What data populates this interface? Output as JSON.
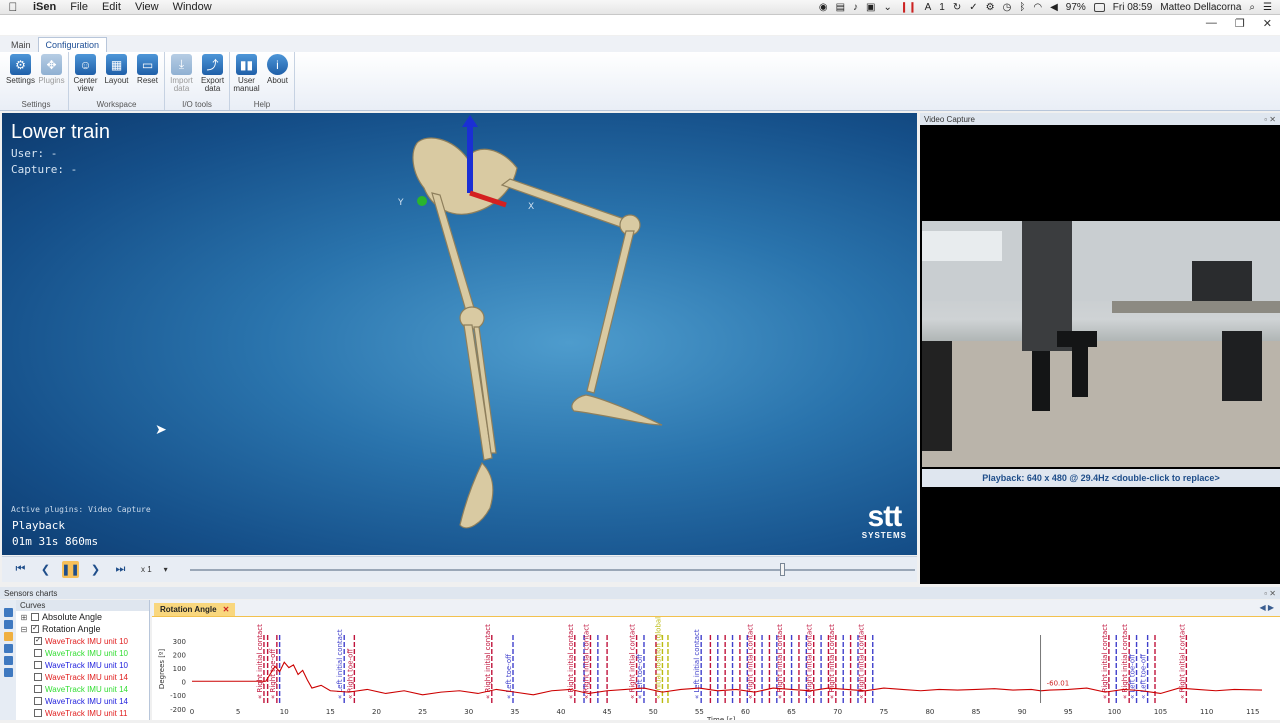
{
  "menubar": {
    "app_name": "iSen",
    "items": [
      "File",
      "Edit",
      "View",
      "Window"
    ],
    "battery": "97%",
    "clock": "Fri 08:59",
    "user": "Matteo Dellacorna",
    "notif_count": "1"
  },
  "window": {
    "minimize": "—",
    "restore": "❐",
    "close": "✕"
  },
  "tabs": [
    "Main",
    "Configuration"
  ],
  "ribbon": {
    "groups": [
      {
        "label": "Settings",
        "buttons": [
          {
            "label": "Settings",
            "icon": "gears-icon"
          },
          {
            "label": "Plugins",
            "icon": "puzzle-icon"
          }
        ]
      },
      {
        "label": "Workspace",
        "buttons": [
          {
            "label": "Center view",
            "icon": "person-center-icon"
          },
          {
            "label": "Layout",
            "icon": "layout-icon"
          },
          {
            "label": "Reset",
            "icon": "reset-icon"
          }
        ]
      },
      {
        "label": "I/O tools",
        "buttons": [
          {
            "label": "Import data",
            "icon": "import-icon"
          },
          {
            "label": "Export data",
            "icon": "export-icon"
          }
        ]
      },
      {
        "label": "Help",
        "buttons": [
          {
            "label": "User manual",
            "icon": "book-icon"
          },
          {
            "label": "About",
            "icon": "info-icon"
          }
        ]
      }
    ]
  },
  "viewport": {
    "title": "Lower train",
    "user_label": "User: -",
    "capture_label": "Capture: -",
    "plugins": "Active plugins: Video Capture",
    "mode": "Playback",
    "time": "01m 31s 860ms",
    "axis_x": "X",
    "axis_y": "Y",
    "logo_main": "stt",
    "logo_sub": "SYSTEMS"
  },
  "playback": {
    "speed": "x 1",
    "progress": 0.82
  },
  "video": {
    "title": "Video Capture",
    "caption": "Playback: 640 x 480 @ 29.4Hz <double-click to replace>"
  },
  "sensors": {
    "title": "Sensors charts",
    "curves_header": "Curves",
    "tree": [
      {
        "label": "Absolute Angle",
        "level": 0,
        "checked": false,
        "color": "#222222"
      },
      {
        "label": "Rotation Angle",
        "level": 0,
        "checked": true,
        "color": "#222222"
      },
      {
        "label": "WaveTrack IMU unit 10",
        "level": 1,
        "checked": true,
        "color": "#e02020"
      },
      {
        "label": "WaveTrack IMU unit 10",
        "level": 1,
        "checked": false,
        "color": "#33dd33"
      },
      {
        "label": "WaveTrack IMU unit 10",
        "level": 1,
        "checked": false,
        "color": "#2222dd"
      },
      {
        "label": "WaveTrack IMU unit 14",
        "level": 1,
        "checked": false,
        "color": "#e02020"
      },
      {
        "label": "WaveTrack IMU unit 14",
        "level": 1,
        "checked": false,
        "color": "#33dd33"
      },
      {
        "label": "WaveTrack IMU unit 14",
        "level": 1,
        "checked": false,
        "color": "#2222dd"
      },
      {
        "label": "WaveTrack IMU unit 11",
        "level": 1,
        "checked": false,
        "color": "#e02020"
      }
    ],
    "chart_tab": "Rotation Angle"
  },
  "chart_data": {
    "type": "line",
    "ylabel": "Degrees [º]",
    "xlabel": "Time [s]",
    "xlim": [
      0,
      116
    ],
    "ylim": [
      -150,
      350
    ],
    "yticks": [
      300,
      200,
      100,
      0,
      -100,
      -200
    ],
    "xticks": [
      0,
      5,
      10,
      15,
      20,
      25,
      30,
      35,
      40,
      45,
      50,
      55,
      60,
      65,
      70,
      75,
      80,
      85,
      90,
      95,
      100,
      105,
      110,
      115
    ],
    "cursor": {
      "x": 92,
      "label": "-60.01"
    },
    "series": [
      {
        "color": "#cc0000",
        "x": [
          0,
          8,
          9,
          9.5,
          10,
          10.5,
          11,
          11.5,
          12,
          12.5,
          13,
          14,
          15,
          17,
          19,
          21,
          23,
          25,
          27,
          29,
          31,
          33,
          35,
          37,
          39,
          41,
          43,
          45,
          47,
          49,
          51,
          53,
          55,
          57,
          59,
          61,
          63,
          65,
          67,
          69,
          71,
          73,
          75,
          77,
          79,
          81,
          83,
          85,
          87,
          89,
          91,
          92,
          93,
          95,
          97,
          99,
          101,
          103,
          105,
          107,
          109,
          111,
          113,
          116
        ],
        "y": [
          10,
          10,
          120,
          80,
          150,
          110,
          130,
          60,
          90,
          20,
          -40,
          -20,
          -60,
          -70,
          -50,
          -80,
          -60,
          -90,
          -70,
          -60,
          -80,
          -50,
          -70,
          -90,
          -60,
          -50,
          -80,
          -60,
          -50,
          -40,
          -70,
          -50,
          -40,
          -60,
          -50,
          -70,
          -40,
          -50,
          -60,
          -40,
          -50,
          -60,
          -40,
          -50,
          -60,
          -50,
          -55,
          -50,
          -45,
          -55,
          -50,
          -60,
          -55,
          -50,
          -40,
          -70,
          -50,
          -60,
          -80,
          -40,
          -50,
          -60,
          -50,
          -55
        ]
      }
    ],
    "events": [
      {
        "x": 7.8,
        "label": "Right initial contact",
        "color": "#c0143c"
      },
      {
        "x": 8.2,
        "label": "",
        "color": "#c0143c"
      },
      {
        "x": 9.2,
        "label": "Right toe-off",
        "color": "#c0143c"
      },
      {
        "x": 9.5,
        "label": "",
        "color": "#4040cc"
      },
      {
        "x": 16.5,
        "label": "Left initial contact",
        "color": "#4040cc"
      },
      {
        "x": 17.6,
        "label": "Right toe-off",
        "color": "#c0143c"
      },
      {
        "x": 32.5,
        "label": "Right initial contact",
        "color": "#c0143c"
      },
      {
        "x": 34.8,
        "label": "Left toe-off",
        "color": "#4040cc"
      },
      {
        "x": 41.5,
        "label": "Right initial contact",
        "color": "#c0143c"
      },
      {
        "x": 42.5,
        "label": "",
        "color": "#4040cc"
      },
      {
        "x": 43.2,
        "label": "Right initial contact",
        "color": "#c0143c"
      },
      {
        "x": 44.0,
        "label": "",
        "color": "#4040cc"
      },
      {
        "x": 45.0,
        "label": "",
        "color": "#c0143c"
      },
      {
        "x": 48.2,
        "label": "Right initial contact",
        "color": "#c0143c"
      },
      {
        "x": 49.0,
        "label": "Left toe-off",
        "color": "#4040cc"
      },
      {
        "x": 50.3,
        "label": "",
        "color": "#c0143c"
      },
      {
        "x": 51.0,
        "label": "Initial position (global)",
        "color": "#bbbb10"
      },
      {
        "x": 51.6,
        "label": "",
        "color": "#bbbb10"
      },
      {
        "x": 55.2,
        "label": "Left initial contact",
        "color": "#4040cc"
      },
      {
        "x": 56.2,
        "label": "",
        "color": "#c0143c"
      },
      {
        "x": 57.0,
        "label": "",
        "color": "#4040cc"
      },
      {
        "x": 57.8,
        "label": "",
        "color": "#c0143c"
      },
      {
        "x": 58.6,
        "label": "",
        "color": "#4040cc"
      },
      {
        "x": 59.4,
        "label": "",
        "color": "#c0143c"
      },
      {
        "x": 60.2,
        "label": "",
        "color": "#4040cc"
      },
      {
        "x": 61.0,
        "label": "Right initial contact",
        "color": "#c0143c"
      },
      {
        "x": 61.8,
        "label": "",
        "color": "#4040cc"
      },
      {
        "x": 62.6,
        "label": "",
        "color": "#c0143c"
      },
      {
        "x": 63.4,
        "label": "",
        "color": "#4040cc"
      },
      {
        "x": 64.2,
        "label": "Right initial contact",
        "color": "#c0143c"
      },
      {
        "x": 65.0,
        "label": "",
        "color": "#4040cc"
      },
      {
        "x": 65.8,
        "label": "",
        "color": "#c0143c"
      },
      {
        "x": 66.6,
        "label": "",
        "color": "#4040cc"
      },
      {
        "x": 67.4,
        "label": "Right initial contact",
        "color": "#c0143c"
      },
      {
        "x": 68.2,
        "label": "",
        "color": "#4040cc"
      },
      {
        "x": 69.0,
        "label": "",
        "color": "#c0143c"
      },
      {
        "x": 69.8,
        "label": "Right initial contact",
        "color": "#c0143c"
      },
      {
        "x": 70.6,
        "label": "",
        "color": "#4040cc"
      },
      {
        "x": 71.4,
        "label": "",
        "color": "#c0143c"
      },
      {
        "x": 72.2,
        "label": "",
        "color": "#4040cc"
      },
      {
        "x": 73.0,
        "label": "Right initial contact",
        "color": "#c0143c"
      },
      {
        "x": 73.8,
        "label": "",
        "color": "#4040cc"
      },
      {
        "x": 99.4,
        "label": "Right initial contact",
        "color": "#c0143c"
      },
      {
        "x": 100.2,
        "label": "",
        "color": "#4040cc"
      },
      {
        "x": 101.6,
        "label": "Right initial contact",
        "color": "#c0143c"
      },
      {
        "x": 102.4,
        "label": "Left toe-off",
        "color": "#4040cc"
      },
      {
        "x": 103.6,
        "label": "Left toe-off",
        "color": "#4040cc"
      },
      {
        "x": 104.4,
        "label": "",
        "color": "#c0143c"
      },
      {
        "x": 107.8,
        "label": "Right initial contact",
        "color": "#c0143c"
      }
    ]
  }
}
